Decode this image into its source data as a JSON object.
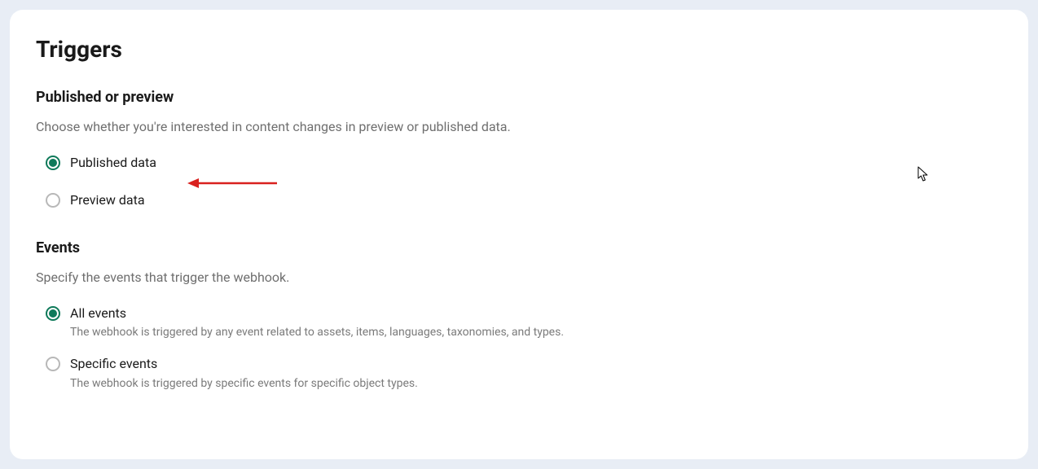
{
  "title": "Triggers",
  "sections": {
    "publishedPreview": {
      "heading": "Published or preview",
      "desc": "Choose whether you're interested in content changes in preview or published data.",
      "options": {
        "published": {
          "label": "Published data",
          "selected": true
        },
        "preview": {
          "label": "Preview data",
          "selected": false
        }
      }
    },
    "events": {
      "heading": "Events",
      "desc": "Specify the events that trigger the webhook.",
      "options": {
        "all": {
          "label": "All events",
          "sub": "The webhook is triggered by any event related to assets, items, languages, taxonomies, and types.",
          "selected": true
        },
        "specific": {
          "label": "Specific events",
          "sub": "The webhook is triggered by specific events for specific object types.",
          "selected": false
        }
      }
    }
  },
  "annotation": {
    "arrowColor": "#d9211e"
  }
}
